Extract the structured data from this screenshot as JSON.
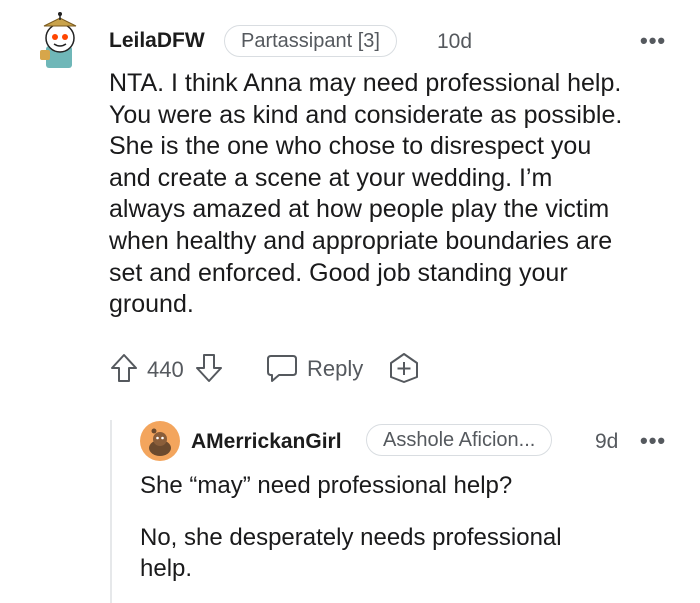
{
  "comment": {
    "username": "LeilaDFW",
    "flair": "Partassipant [3]",
    "time": "10d",
    "more": "•••",
    "body_lines": [
      "NTA. I think Anna may need professional help.",
      "You were as kind and considerate as possible.",
      "She is the one who chose to disrespect you",
      "and create a scene at your wedding. I’m",
      "always amazed at how people play the victim",
      "when healthy and appropriate boundaries are",
      "set and enforced. Good job standing your",
      "ground."
    ],
    "votes": "440",
    "reply_label": "Reply"
  },
  "reply": {
    "username": "AMerrickanGirl",
    "flair": "Asshole Aficion...",
    "time": "9d",
    "more": "•••",
    "paragraph1": "She “may” need professional help?",
    "paragraph2_lines": [
      "No, she desperately needs professional",
      "help."
    ]
  },
  "colors": {
    "text": "#1a1a1b",
    "muted": "#55595e",
    "avatar_orange": "#f3a55d"
  }
}
